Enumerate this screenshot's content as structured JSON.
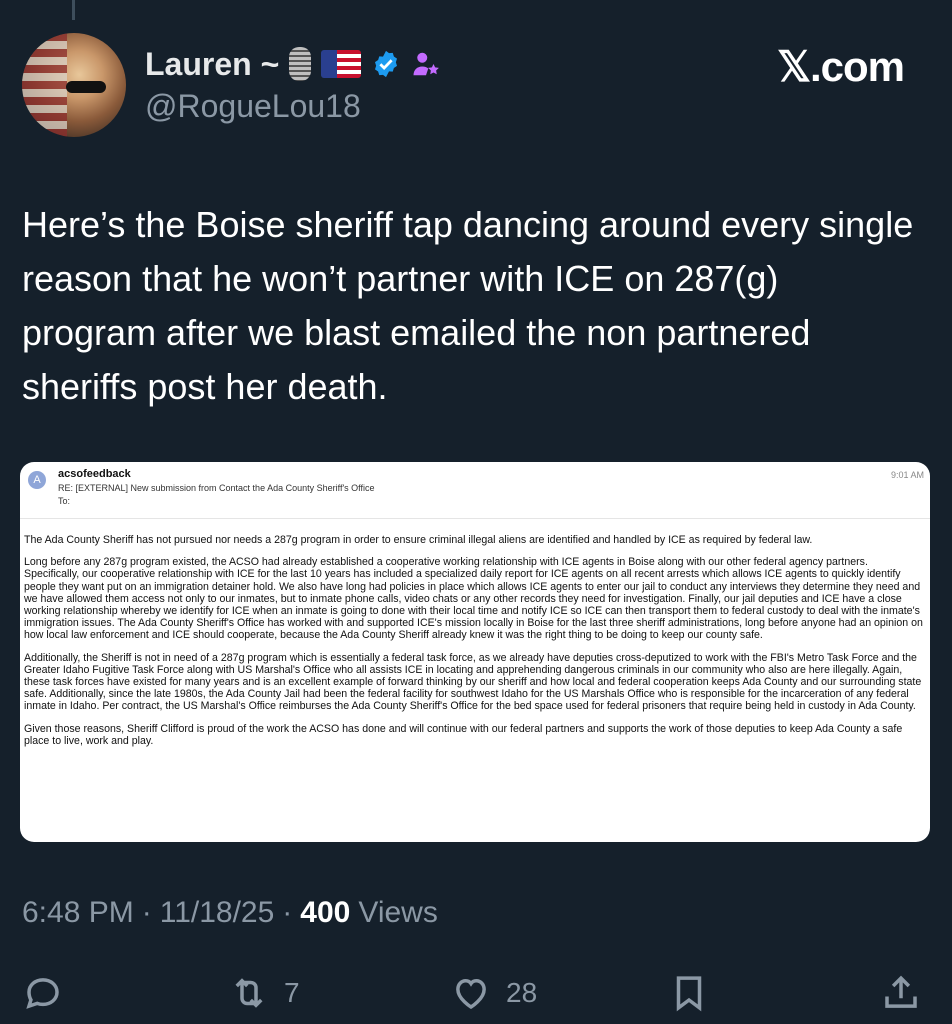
{
  "tweet": {
    "display_name": "Lauren ~",
    "handle": "@RogueLou18",
    "brand": "𝕏.com",
    "text": "Here’s the Boise sheriff tap dancing around every single reason that he won’t partner with ICE on 287(g) program after we blast emailed the non partnered sheriffs post her death.",
    "time": "6:48 PM",
    "date": "11/18/25",
    "views_count": "400",
    "views_label": "Views",
    "badges": [
      "microphone-icon",
      "us-flag-icon",
      "verified-badge-icon",
      "person-star-icon"
    ]
  },
  "email": {
    "avatar_letter": "A",
    "from": "acsofeedback",
    "subject": "RE: [EXTERNAL] New submission from Contact the Ada County Sheriff's Office",
    "to": "To:",
    "time": "9:01 AM",
    "paragraphs": [
      "The Ada County Sheriff has not pursued nor needs a 287g program in order to ensure criminal illegal aliens are identified and handled by ICE as required by federal law.",
      "Long before any 287g program existed, the ACSO had already established a cooperative working relationship with ICE agents in Boise along with our other federal agency partners. Specifically, our cooperative relationship with ICE for the last 10 years has included a specialized daily report for ICE agents on all recent arrests which allows ICE agents to quickly identify people they want put on an immigration detainer hold. We also have long had policies in place which allows ICE agents to enter our jail to conduct any interviews they determine they need and we have allowed them access not only to our inmates, but to inmate phone calls, video chats or any other records they need for investigation. Finally, our jail deputies and ICE have a close working relationship whereby we identify for ICE when an inmate is going to done with their local time and notify ICE so ICE can then transport them to federal custody to deal with the inmate's immigration issues. The Ada County Sheriff's Office has worked with and supported ICE's mission locally in Boise for the last three sheriff administrations, long before anyone had an opinion on how local law enforcement and ICE should cooperate, because the Ada County Sheriff already knew it was the right thing to be doing to keep our county safe.",
      "Additionally, the Sheriff is not in need of a 287g program which is essentially a federal task force, as we already have deputies cross-deputized to work with the FBI's Metro Task Force and the Greater Idaho Fugitive Task Force along with US Marshal's Office who all assists ICE in locating and apprehending dangerous criminals in our community who also are here illegally. Again, these task forces have existed for many years and is an excellent example of forward thinking by our sheriff and how local and federal cooperation keeps Ada County and our surrounding state safe. Additionally, since the late 1980s, the Ada County Jail had been the federal facility for southwest Idaho for the US Marshals Office who is responsible for the incarceration of any federal inmate in Idaho. Per contract, the US Marshal's Office reimburses the Ada County Sheriff's Office for the bed space used for federal prisoners that require being held in custody in Ada County.",
      "Given those reasons, Sheriff Clifford is proud of the work the ACSO has done and will continue with our federal partners and supports the work of those deputies to keep Ada County a safe place to live, work and play."
    ]
  },
  "actions": {
    "reply_icon": "reply-icon",
    "retweet_count": "7",
    "like_count": "28",
    "bookmark_icon": "bookmark-icon",
    "share_icon": "share-icon"
  },
  "colors": {
    "background": "#15202b",
    "secondary_text": "#8b98a5",
    "verified_blue": "#1d9bf0"
  }
}
